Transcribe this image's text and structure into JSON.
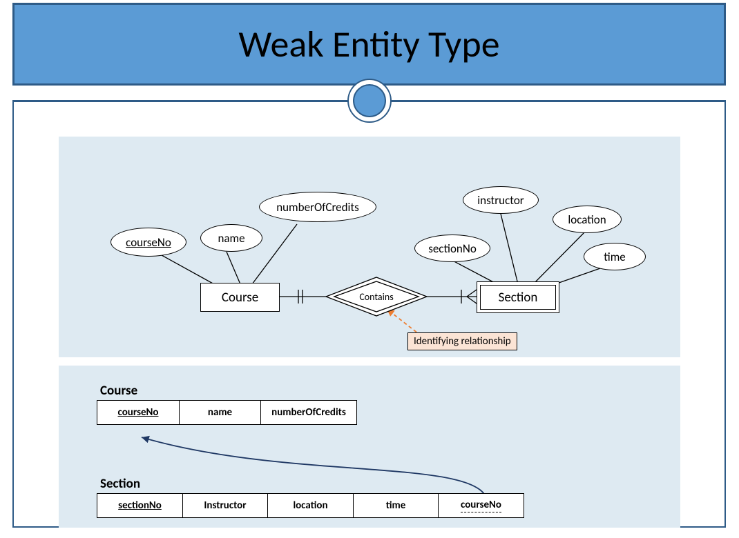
{
  "title": "Weak Entity Type",
  "er": {
    "strongEntity": "Course",
    "weakEntity": "Section",
    "relationship": "Contains",
    "attributes": {
      "course": {
        "key": "courseNo",
        "a2": "name",
        "a3": "numberOfCredits"
      },
      "section": {
        "partialKey": "sectionNo",
        "a2": "instructor",
        "a3": "location",
        "a4": "time"
      }
    },
    "calloutLabel": "Identifying relationship"
  },
  "schema": {
    "courseLabel": "Course",
    "course": {
      "c1": "courseNo",
      "c2": "name",
      "c3": "numberOfCredits"
    },
    "sectionLabel": "Section",
    "section": {
      "c1": "sectionNo",
      "c2": "Instructor",
      "c3": "location",
      "c4": "time",
      "c5": "courseNo"
    }
  }
}
